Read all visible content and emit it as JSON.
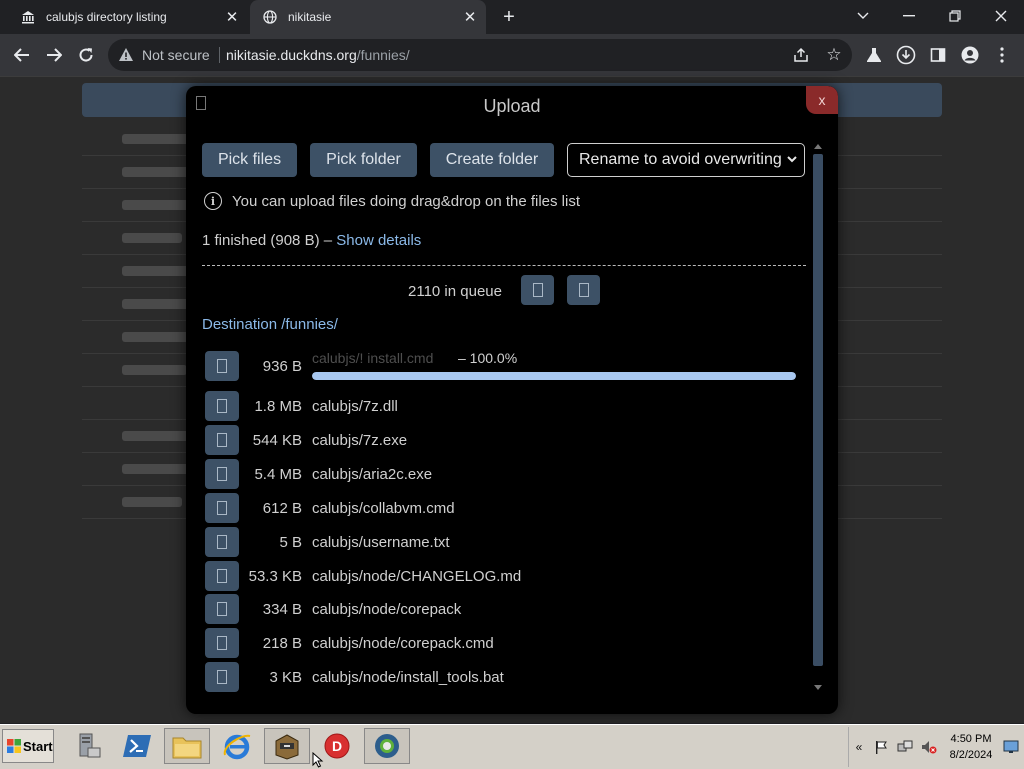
{
  "browser": {
    "tabs": [
      {
        "title": "calubjs directory listing",
        "active": false,
        "icon": "institution-icon"
      },
      {
        "title": "nikitasie",
        "active": true,
        "icon": "globe-icon"
      }
    ],
    "address": {
      "security": "Not secure",
      "host": "nikitasie.duckdns.org",
      "path": "/funnies/"
    }
  },
  "dialog": {
    "title": "Upload",
    "close_label": "x",
    "buttons": {
      "pick_files": "Pick files",
      "pick_folder": "Pick folder",
      "create_folder": "Create folder"
    },
    "mode_select": {
      "selected": "Rename to avoid overwriting"
    },
    "info_text": "You can upload files doing drag&drop on the files list",
    "status": {
      "summary": "1 finished (908 B) – ",
      "details_link": "Show details"
    },
    "queue_text": "2110 in queue",
    "destination": "Destination /funnies/",
    "current_upload": {
      "size": "936 B",
      "name": "calubjs/! install.cmd",
      "progress_text": "– 100.0%",
      "progress": 1.0
    },
    "queue_items": [
      {
        "size": "1.8 MB",
        "name": "calubjs/7z.dll"
      },
      {
        "size": "544 KB",
        "name": "calubjs/7z.exe"
      },
      {
        "size": "5.4 MB",
        "name": "calubjs/aria2c.exe"
      },
      {
        "size": "612 B",
        "name": "calubjs/collabvm.cmd"
      },
      {
        "size": "5 B",
        "name": "calubjs/username.txt"
      },
      {
        "size": "53.3 KB",
        "name": "calubjs/node/CHANGELOG.md"
      },
      {
        "size": "334 B",
        "name": "calubjs/node/corepack"
      },
      {
        "size": "218 B",
        "name": "calubjs/node/corepack.cmd"
      },
      {
        "size": "3 KB",
        "name": "calubjs/node/install_tools.bat"
      }
    ]
  },
  "taskbar": {
    "start_label": "Start",
    "clock_time": "4:50 PM",
    "clock_date": "8/2/2024"
  },
  "colors": {
    "accent_button": "#3d5166",
    "link": "#8bb9e8",
    "progress": "#a8c8f0",
    "close": "#8a2a2a"
  }
}
